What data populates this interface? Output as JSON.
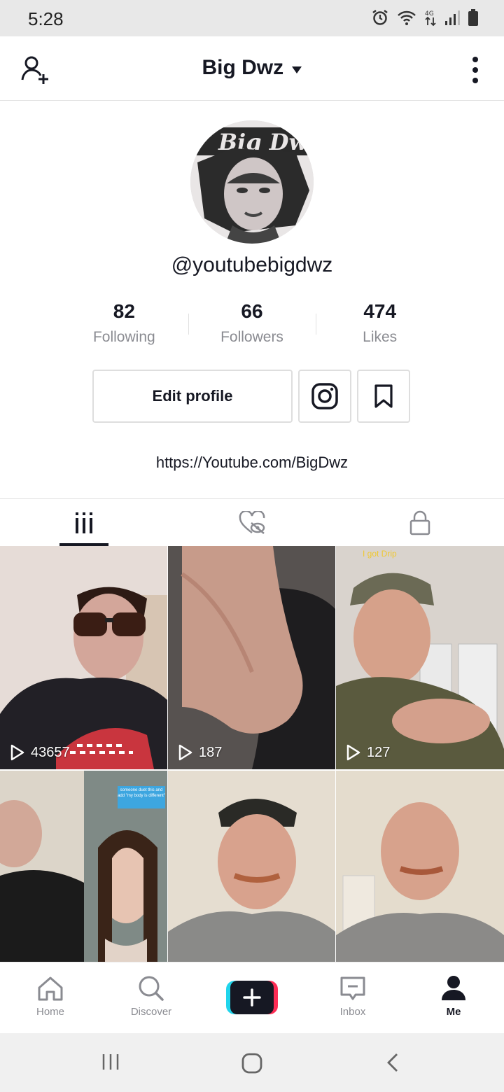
{
  "status_bar": {
    "time": "5:28"
  },
  "header": {
    "title": "Big Dwz"
  },
  "profile": {
    "handle": "@youtubebigdwz",
    "stats": [
      {
        "value": "82",
        "label": "Following"
      },
      {
        "value": "66",
        "label": "Followers"
      },
      {
        "value": "474",
        "label": "Likes"
      }
    ],
    "edit_button": "Edit profile",
    "bio_link": "https://Youtube.com/BigDwz"
  },
  "videos": [
    {
      "views": "43657"
    },
    {
      "views": "187"
    },
    {
      "views": "127",
      "overlay": "I got Drip"
    },
    {
      "views": "",
      "overlay": "someone duet this and add \"my body is different\""
    },
    {
      "views": ""
    },
    {
      "views": ""
    }
  ],
  "bottom_nav": {
    "home": "Home",
    "discover": "Discover",
    "inbox": "Inbox",
    "me": "Me"
  }
}
